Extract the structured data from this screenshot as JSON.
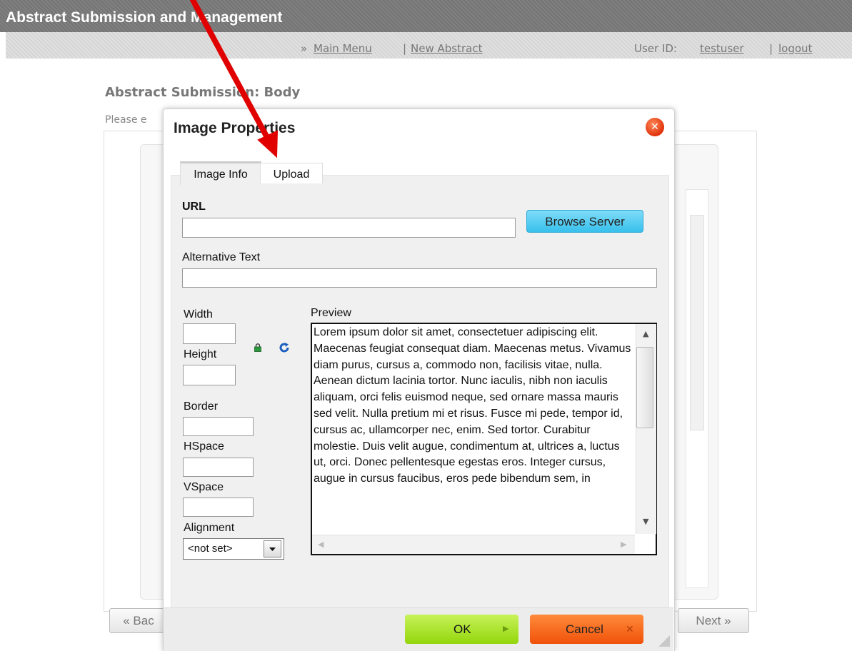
{
  "header": {
    "title": "Abstract Submission and Management"
  },
  "nav": {
    "prefix": "»",
    "main_menu": "Main Menu",
    "separator": "|",
    "new_abstract": "New Abstract",
    "user_id_label": "User ID:",
    "user_id": "testuser",
    "logout": "logout"
  },
  "page": {
    "heading": "Abstract Submission: Body",
    "instructions": "Please e",
    "back_button": "« Bac",
    "next_button": "Next »"
  },
  "dialog": {
    "title": "Image Properties",
    "tabs": [
      {
        "label": "Image Info",
        "active": true
      },
      {
        "label": "Upload",
        "active": false
      }
    ],
    "url_label": "URL",
    "url_value": "",
    "browse_button": "Browse Server",
    "alt_label": "Alternative Text",
    "alt_value": "",
    "width_label": "Width",
    "height_label": "Height",
    "border_label": "Border",
    "hspace_label": "HSpace",
    "vspace_label": "VSpace",
    "alignment_label": "Alignment",
    "alignment_value": "<not set>",
    "preview_label": "Preview",
    "preview_text": "Lorem ipsum dolor sit amet, consectetuer adipiscing elit. Maecenas feugiat consequat diam. Maecenas metus. Vivamus diam purus, cursus a, commodo non, facilisis vitae, nulla. Aenean dictum lacinia tortor. Nunc iaculis, nibh non iaculis aliquam, orci felis euismod neque, sed ornare massa mauris sed velit. Nulla pretium mi et risus. Fusce mi pede, tempor id, cursus ac, ullamcorper nec, enim. Sed tortor. Curabitur molestie. Duis velit augue, condimentum at, ultrices a, luctus ut, orci. Donec pellentesque egestas eros. Integer cursus, augue in cursus faucibus, eros pede bibendum sem, in",
    "ok_button": "OK",
    "cancel_button": "Cancel"
  },
  "icons": {
    "lock": "lock-icon",
    "reset": "reset-size-icon",
    "close": "close-icon"
  },
  "colors": {
    "header_bg": "#7a7a7a",
    "link": "#2a6fc9",
    "ok": "#93d60c",
    "cancel": "#f0520a",
    "browse": "#37c0ec",
    "annotation_arrow": "#e00000"
  }
}
